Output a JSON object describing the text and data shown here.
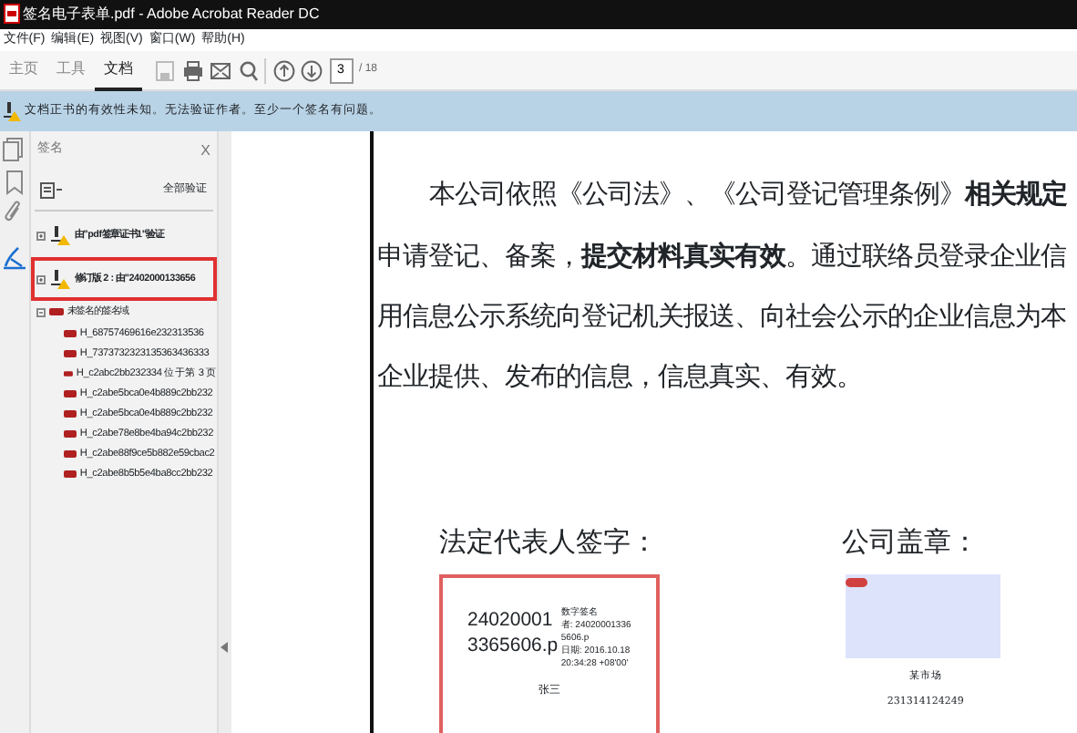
{
  "window": {
    "title": "签名电子表单.pdf - Adobe Acrobat Reader DC"
  },
  "menu": [
    "文件(F)",
    "编辑(E)",
    "视图(V)",
    "窗口(W)",
    "帮助(H)"
  ],
  "tabs": [
    {
      "label": "主页",
      "selected": false
    },
    {
      "label": "工具",
      "selected": false
    },
    {
      "label": "文档",
      "selected": true
    }
  ],
  "toolbar": {
    "page": "3",
    "page_total": "/ 18"
  },
  "notice": "文档正书的有效性未知。无法验证作者。至少一个签名有问题。",
  "side_icons": [
    {
      "kind": "pages",
      "selected": false
    },
    {
      "kind": "bookmark",
      "selected": false
    },
    {
      "kind": "attachment",
      "selected": false
    },
    {
      "kind": "signature",
      "selected": true
    }
  ],
  "panel": {
    "title": "签名",
    "close": "X",
    "verify_all": "全部验证",
    "tree": [
      {
        "kind": "signature",
        "label": "由\"pdf签章证书1\"验证",
        "expanded": false,
        "selected": false
      },
      {
        "kind": "signature",
        "label": "修订版 2 : 由\"2402000133656",
        "expanded": false,
        "selected": true
      },
      {
        "kind": "field_group",
        "label": "未签名的签名域",
        "expanded": true,
        "selected": false,
        "children": [
          {
            "label": "H_68757469616e232313536"
          },
          {
            "label": "H_7373732323135363436333"
          },
          {
            "label": "H_c2abc2bb232334 位于第 3 页"
          },
          {
            "label": "H_c2abe5bca0e4b889c2bb232"
          },
          {
            "label": "H_c2abe5bca0e4b889c2bb232"
          },
          {
            "label": "H_c2abe78e8be4ba94c2bb232"
          },
          {
            "label": "H_c2abe88f9ce5b882e59cbac2"
          },
          {
            "label": "H_c2abe8b5b5e4ba8cc2bb232"
          }
        ]
      }
    ]
  },
  "document": {
    "paragraph": "本公司依照《公司法》、《公司登记管理条例》**相关规定**申请登记、备案，**提交材料真实有效**。通过联络员登录企业信用信息公示系统向登记机关报送、向社会公示的企业信息为本企业提供、发布的信息，信息真实、有效。",
    "rep_label": "法定代表人签字：",
    "seal_label": "公司盖章：",
    "signature": {
      "big": [
        "24020001",
        "3365606.p"
      ],
      "small": [
        "数字签名",
        "者: 24020001336",
        "5606.p",
        "日期: 2016.10.18",
        "20:34:28 +08'00'"
      ],
      "name": "张三"
    },
    "seal": {
      "name": "某市场",
      "code": "231314124249"
    }
  }
}
